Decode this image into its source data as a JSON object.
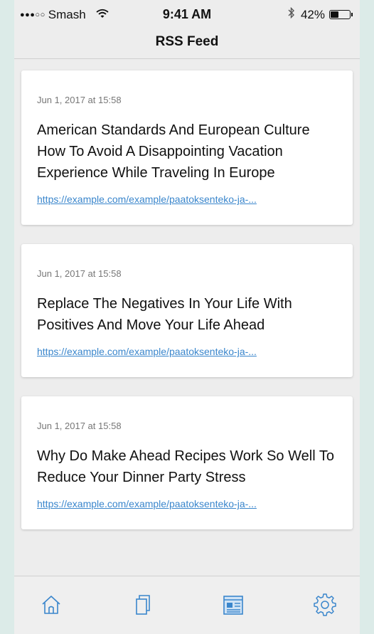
{
  "status_bar": {
    "signal": "●●●○○",
    "carrier": "Smash",
    "wifi_icon": "wifi-icon",
    "time": "9:41 AM",
    "bluetooth_icon": "bluetooth-icon",
    "battery": "42%",
    "battery_level": 0.42
  },
  "nav": {
    "title": "RSS Feed"
  },
  "feed": {
    "items": [
      {
        "date": "Jun 1, 2017 at 15:58",
        "title": "American Standards And European Culture How To Avoid A Disappointing Vacation Experience While Traveling In Europe",
        "link": "https://example.com/example/paatoksenteko-ja-..."
      },
      {
        "date": "Jun 1, 2017 at 15:58",
        "title": "Replace The Negatives In Your Life With Positives And Move Your Life Ahead",
        "link": "https://example.com/example/paatoksenteko-ja-..."
      },
      {
        "date": "Jun 1, 2017 at 15:58",
        "title": "Why Do Make Ahead Recipes Work So Well To Reduce Your Dinner Party Stress",
        "link": "https://example.com/example/paatoksenteko-ja-..."
      }
    ]
  },
  "tab_bar": {
    "tabs": [
      {
        "icon": "home-icon",
        "active": false
      },
      {
        "icon": "copy-icon",
        "active": false
      },
      {
        "icon": "newspaper-icon",
        "active": true
      },
      {
        "icon": "gear-icon",
        "active": false
      }
    ],
    "accent_color": "#3a86cc"
  }
}
